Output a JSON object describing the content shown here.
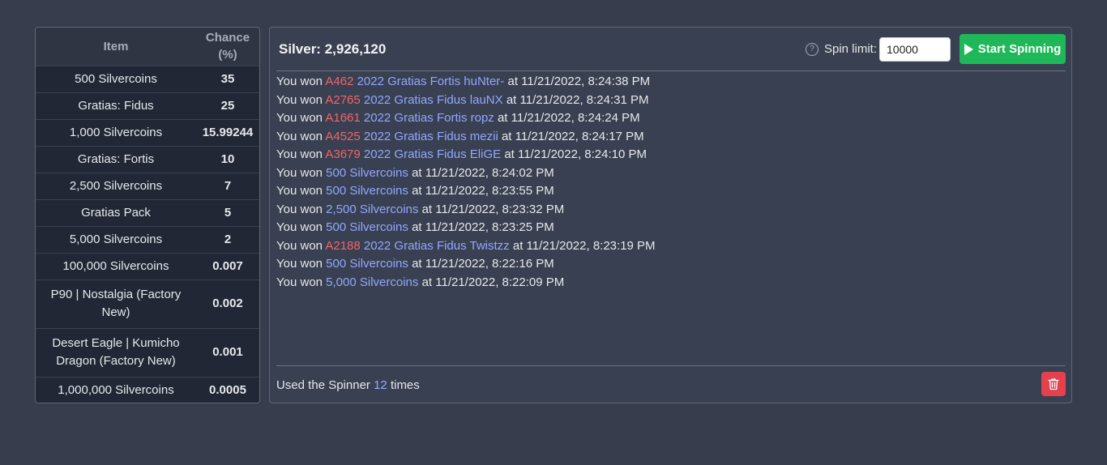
{
  "odds_table": {
    "header_item": "Item",
    "header_chance": "Chance (%)",
    "rows": [
      {
        "item": "500 Silvercoins",
        "chance": "35"
      },
      {
        "item": "Gratias: Fidus",
        "chance": "25"
      },
      {
        "item": "1,000 Silvercoins",
        "chance": "15.99244"
      },
      {
        "item": "Gratias: Fortis",
        "chance": "10"
      },
      {
        "item": "2,500 Silvercoins",
        "chance": "7"
      },
      {
        "item": "Gratias Pack",
        "chance": "5"
      },
      {
        "item": "5,000 Silvercoins",
        "chance": "2"
      },
      {
        "item": "100,000 Silvercoins",
        "chance": "0.007"
      },
      {
        "item": "P90 | Nostalgia (Factory New)",
        "chance": "0.002"
      },
      {
        "item": "Desert Eagle | Kumicho Dragon (Factory New)",
        "chance": "0.001"
      },
      {
        "item": "1,000,000 Silvercoins",
        "chance": "0.0005"
      }
    ]
  },
  "spinner": {
    "silver_label": "Silver: 2,926,120",
    "spin_limit_label": "Spin limit:",
    "spin_limit_value": "10000",
    "start_button": "Start Spinning",
    "log": [
      {
        "prefix": "You won",
        "id": "A462",
        "item": "2022 Gratias Fortis huNter-",
        "suffix": "at 11/21/2022, 8:24:38 PM"
      },
      {
        "prefix": "You won",
        "id": "A2765",
        "item": "2022 Gratias Fidus lauNX",
        "suffix": "at 11/21/2022, 8:24:31 PM"
      },
      {
        "prefix": "You won",
        "id": "A1661",
        "item": "2022 Gratias Fortis ropz",
        "suffix": "at 11/21/2022, 8:24:24 PM"
      },
      {
        "prefix": "You won",
        "id": "A4525",
        "item": "2022 Gratias Fidus mezii",
        "suffix": "at 11/21/2022, 8:24:17 PM"
      },
      {
        "prefix": "You won",
        "id": "A3679",
        "item": "2022 Gratias Fidus EliGE",
        "suffix": "at 11/21/2022, 8:24:10 PM"
      },
      {
        "prefix": "You won",
        "id": "",
        "item": "500 Silvercoins",
        "suffix": "at 11/21/2022, 8:24:02 PM"
      },
      {
        "prefix": "You won",
        "id": "",
        "item": "500 Silvercoins",
        "suffix": "at 11/21/2022, 8:23:55 PM"
      },
      {
        "prefix": "You won",
        "id": "",
        "item": "2,500 Silvercoins",
        "suffix": "at 11/21/2022, 8:23:32 PM"
      },
      {
        "prefix": "You won",
        "id": "",
        "item": "500 Silvercoins",
        "suffix": "at 11/21/2022, 8:23:25 PM"
      },
      {
        "prefix": "You won",
        "id": "A2188",
        "item": "2022 Gratias Fidus Twistzz",
        "suffix": "at 11/21/2022, 8:23:19 PM"
      },
      {
        "prefix": "You won",
        "id": "",
        "item": "500 Silvercoins",
        "suffix": "at 11/21/2022, 8:22:16 PM"
      },
      {
        "prefix": "You won",
        "id": "",
        "item": "5,000 Silvercoins",
        "suffix": "at 11/21/2022, 8:22:09 PM"
      }
    ],
    "usage_prefix": "Used the Spinner",
    "usage_count": "12",
    "usage_suffix": "times"
  },
  "colors": {
    "background": "#373d4c",
    "table_body": "#212734",
    "accent_blue": "#93a7ff",
    "accent_red": "#f0656b",
    "start_green": "#1fb858",
    "delete_red": "#e5414c"
  },
  "icons": {
    "help": "question-circle-icon",
    "start": "play-icon",
    "clear": "trash-icon"
  }
}
